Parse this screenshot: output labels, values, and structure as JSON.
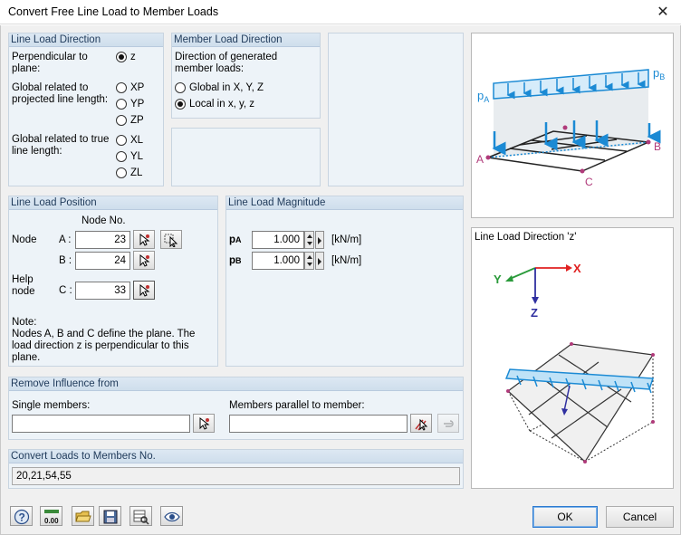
{
  "window": {
    "title": "Convert Free Line Load to Member Loads",
    "close_glyph": "✕"
  },
  "line_load_direction": {
    "heading": "Line Load Direction",
    "perpendicular_label": "Perpendicular to plane:",
    "projected_label": "Global related to projected line length:",
    "true_label": "Global related to true line length:",
    "options": {
      "z": "z",
      "xp": "XP",
      "yp": "YP",
      "zp": "ZP",
      "xl": "XL",
      "yl": "YL",
      "zl": "ZL"
    },
    "selected": "z"
  },
  "member_load_direction": {
    "heading": "Member Load Direction",
    "description": "Direction of generated member loads:",
    "global_label": "Global in X, Y, Z",
    "local_label": "Local in x, y, z",
    "selected": "local"
  },
  "line_load_position": {
    "heading": "Line Load Position",
    "node_no_header": "Node No.",
    "node_label": "Node",
    "help_node_label": "Help node",
    "a_label": "A :",
    "b_label": "B :",
    "c_label": "C :",
    "a_value": "23",
    "b_value": "24",
    "c_value": "33",
    "note_title": "Note:",
    "note_text": "Nodes A, B and C define the plane. The load direction z is perpendicular to this plane."
  },
  "line_load_magnitude": {
    "heading": "Line Load Magnitude",
    "pa_label": "p",
    "pa_sub": "A",
    "pb_label": "p",
    "pb_sub": "B",
    "pa_value": "1.000",
    "pb_value": "1.000",
    "unit": "[kN/m]"
  },
  "remove_influence": {
    "heading": "Remove Influence from",
    "single_label": "Single members:",
    "single_value": "",
    "parallel_label": "Members parallel to member:",
    "parallel_value": ""
  },
  "convert_loads": {
    "heading": "Convert Loads to Members No.",
    "value": "20,21,54,55"
  },
  "diagram_top": {
    "pa": "p",
    "pa_sub": "A",
    "pb": "p",
    "pb_sub": "B",
    "node_a": "A",
    "node_b": "B",
    "node_c": "C"
  },
  "diagram_bottom": {
    "caption": "Line Load Direction 'z'",
    "axis_x": "X",
    "axis_y": "Y",
    "axis_z": "Z"
  },
  "footer": {
    "ok_label": "OK",
    "cancel_label": "Cancel",
    "units_icon_text": "0.00"
  },
  "colors": {
    "load_blue": "#1b8ad4",
    "node_magenta": "#b03a7a",
    "x_axis": "#e02020",
    "y_axis": "#2a9a3a",
    "z_axis": "#3030a0"
  }
}
